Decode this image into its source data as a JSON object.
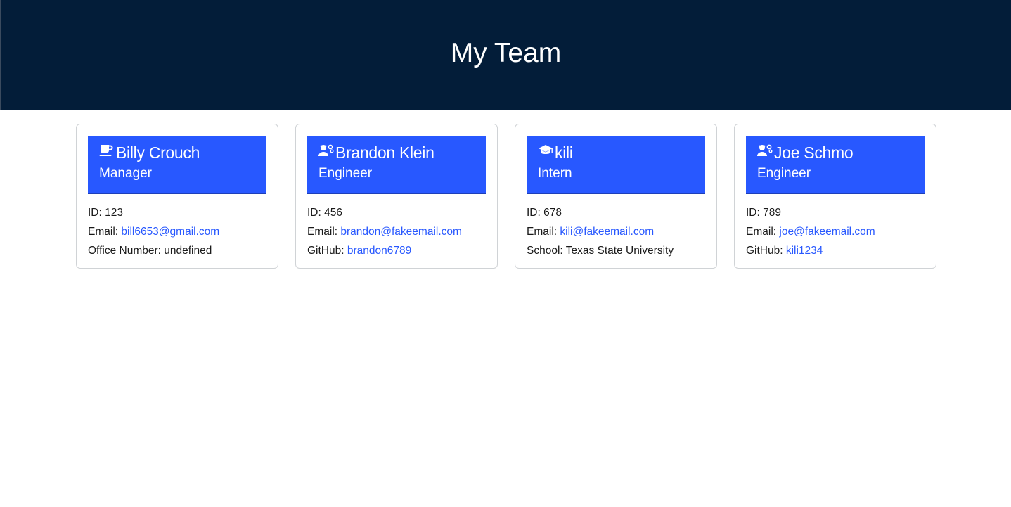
{
  "header": {
    "title": "My Team"
  },
  "team": [
    {
      "icon": "coffee-mug-icon",
      "name": "Billy Crouch",
      "role": "Manager",
      "id_label": "ID: ",
      "id": "123",
      "email_label": "Email: ",
      "email": "bill6653@gmail.com",
      "extra_label": "Office Number: ",
      "extra": "undefined"
    },
    {
      "icon": "engineer-gear-icon",
      "name": "Brandon Klein",
      "role": "Engineer",
      "id_label": "ID: ",
      "id": "456",
      "email_label": "Email: ",
      "email": "brandon@fakeemail.com",
      "extra_label": "GitHub: ",
      "extra": "brandon6789"
    },
    {
      "icon": "graduation-cap-icon",
      "name": "kili",
      "role": "Intern",
      "id_label": "ID: ",
      "id": "678",
      "email_label": "Email: ",
      "email": "kili@fakeemail.com",
      "extra_label": "School: ",
      "extra": "Texas State University"
    },
    {
      "icon": "engineer-gear-icon",
      "name": "Joe Schmo",
      "role": "Engineer",
      "id_label": "ID: ",
      "id": "789",
      "email_label": "Email: ",
      "email": "joe@fakeemail.com",
      "extra_label": "GitHub: ",
      "extra": "kili1234"
    }
  ],
  "colors": {
    "header_bg": "#031d39",
    "card_header_bg": "#2858ff",
    "link": "#2858ff"
  }
}
